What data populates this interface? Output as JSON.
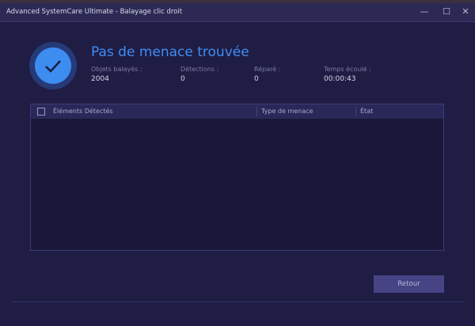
{
  "window": {
    "title": "Advanced SystemCare Ultimate - Balayage clic droit",
    "minimize": "—",
    "maximize": "☐",
    "close": "✕"
  },
  "result": {
    "heading": "Pas de menace trouvée",
    "stats": [
      {
        "label": "Objets balayés :",
        "value": "2004"
      },
      {
        "label": "Détections :",
        "value": "0"
      },
      {
        "label": "Réparé :",
        "value": "0"
      },
      {
        "label": "Temps écoulé :",
        "value": "00:00:43"
      }
    ]
  },
  "table": {
    "columns": [
      "Éléments Détectés",
      "Type de menace",
      "État"
    ],
    "rows": []
  },
  "footer": {
    "back_label": "Retour"
  }
}
